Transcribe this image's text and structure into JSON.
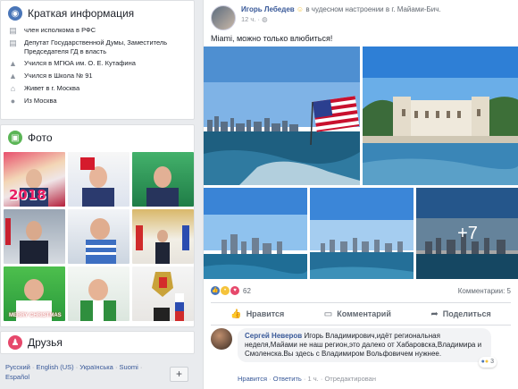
{
  "intro": {
    "title": "Краткая информация",
    "items": [
      {
        "icon": "briefcase-icon",
        "text": "член исполкома в РФС"
      },
      {
        "icon": "briefcase-icon",
        "text": "Депутат Государственной Думы, Заместитель Председателя ГД в власть"
      },
      {
        "icon": "graduation-cap-icon",
        "text": "Учился в МГЮА им. О. Е. Кутафина"
      },
      {
        "icon": "graduation-cap-icon",
        "text": "Учился в Школа № 91"
      },
      {
        "icon": "home-icon",
        "text": "Живет в г. Москва"
      },
      {
        "icon": "location-pin-icon",
        "text": "Из Москва"
      }
    ]
  },
  "photos": {
    "title": "Фото",
    "tile_texts": [
      "2018",
      "MERRY CHRISTMAS"
    ]
  },
  "friends": {
    "title": "Друзья"
  },
  "footer": {
    "languages": [
      "Русский",
      "English (US)",
      "Українська",
      "Suomi",
      "Español"
    ],
    "plus_label": "+"
  },
  "post": {
    "author": "Игорь Лебедев",
    "feeling": "в чудесном настроении в г. Майами-Бич.",
    "time": "12 ч.",
    "text": "Miami, можно только влюбиться!",
    "more_photos": "+7",
    "reactions_count": "62",
    "comments_count": "Комментарии: 5",
    "actions": {
      "like": "Нравится",
      "comment": "Комментарий",
      "share": "Поделиться"
    }
  },
  "comment": {
    "author": "Сергей Неверов",
    "text": "Игорь Владимирович,идёт региональная неделя,Майами не наш регион,это далеко от Хабаровска,Владимира и Смоленска.Вы здесь с Владимиром Вольфовичем нужнее.",
    "reactions": "3",
    "links": {
      "like": "Нравится",
      "reply": "Ответить",
      "time": "1 ч.",
      "edited": "Отредактирован"
    }
  },
  "colors": {
    "link": "#385898",
    "bg": "#e9ebee",
    "green": "#5bb556",
    "pink": "#e6486b",
    "blue": "#4a76b8"
  }
}
